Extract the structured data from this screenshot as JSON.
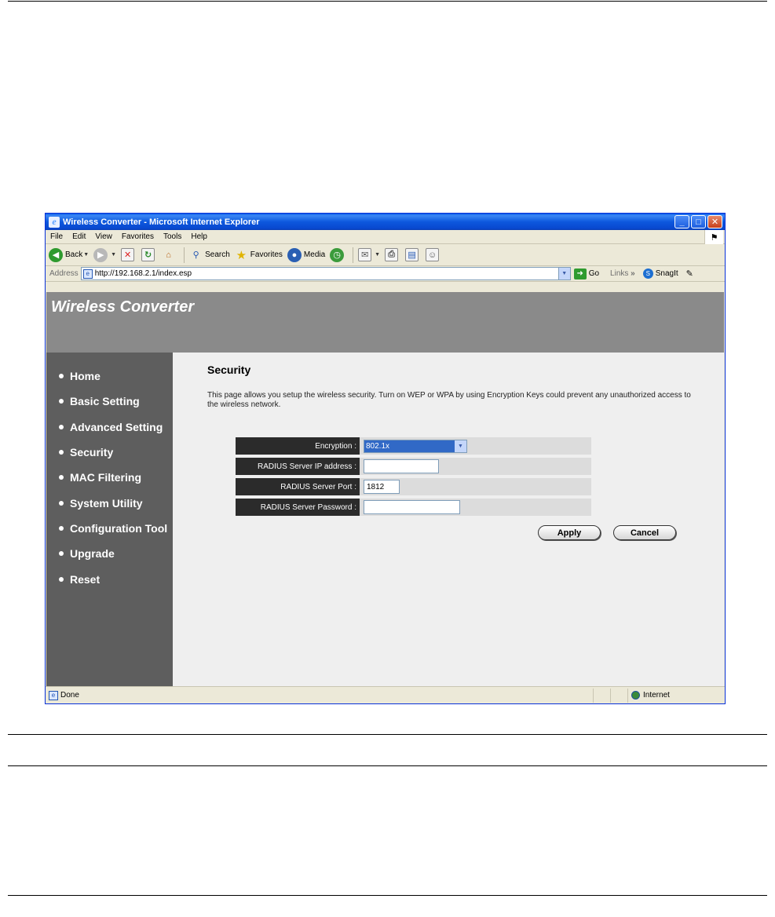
{
  "window": {
    "title": "Wireless Converter - Microsoft Internet Explorer",
    "controls": {
      "minimize": "_",
      "maximize": "□",
      "close": "✕"
    }
  },
  "menubar": {
    "items": [
      "File",
      "Edit",
      "View",
      "Favorites",
      "Tools",
      "Help"
    ]
  },
  "toolbar": {
    "back_label": "Back",
    "search_label": "Search",
    "favorites_label": "Favorites",
    "media_label": "Media"
  },
  "addressbar": {
    "label": "Address",
    "url": "http://192.168.2.1/index.esp",
    "go_label": "Go",
    "links_label": "Links",
    "links_chevron": "»",
    "snagit_label": "SnagIt"
  },
  "site": {
    "banner_title": "Wireless Converter",
    "nav": [
      "Home",
      "Basic Setting",
      "Advanced Setting",
      "Security",
      "MAC Filtering",
      "System Utility",
      "Configuration Tool",
      "Upgrade",
      "Reset"
    ]
  },
  "security_page": {
    "title": "Security",
    "description": "This page allows you setup the wireless security. Turn on WEP or WPA by using Encryption Keys could prevent any unauthorized access to the wireless network.",
    "fields": {
      "encryption_label": "Encryption :",
      "encryption_value": "802.1x",
      "radius_ip_label": "RADIUS Server IP address :",
      "radius_ip_value": "",
      "radius_port_label": "RADIUS Server Port :",
      "radius_port_value": "1812",
      "radius_password_label": "RADIUS Server Password :",
      "radius_password_value": ""
    },
    "apply_label": "Apply",
    "cancel_label": "Cancel"
  },
  "statusbar": {
    "status_text": "Done",
    "zone_text": "Internet"
  },
  "colors": {
    "banner": "#8a8a8a",
    "nav_background": "#5e5e5e",
    "label_background": "#2b2b2b",
    "select_highlight": "#3169c6",
    "titlebar": "#0a5be8"
  }
}
